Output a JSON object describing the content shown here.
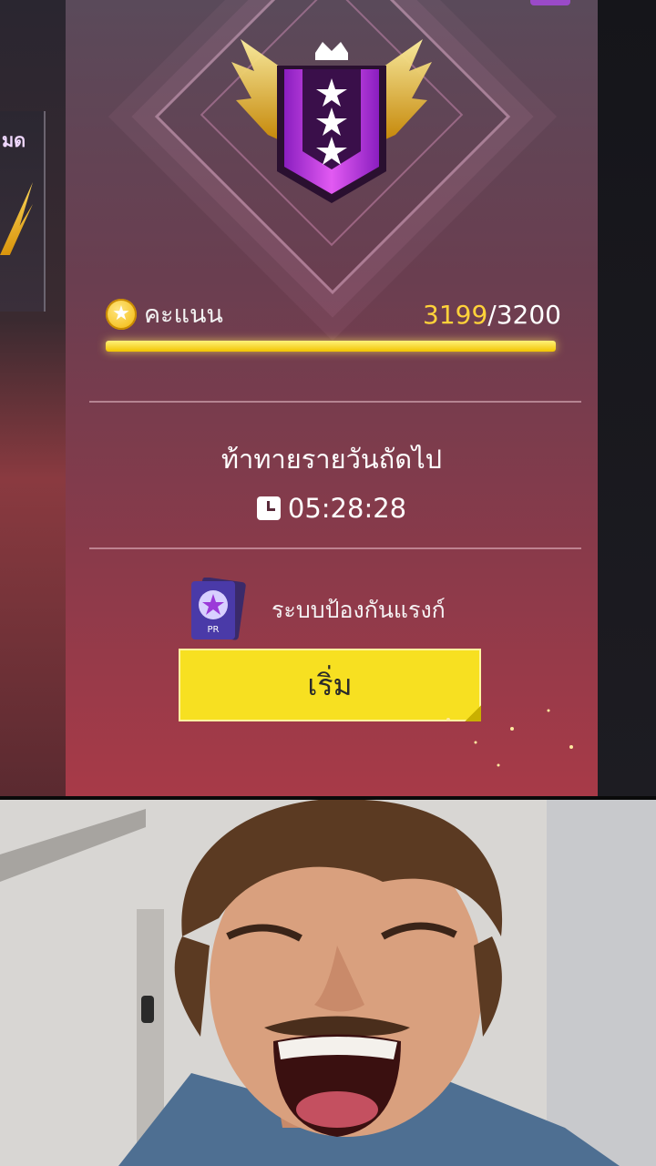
{
  "game": {
    "left_card_label": "มด",
    "score": {
      "label": "คะแนน",
      "current": "3199",
      "separator": "/",
      "max": "3200",
      "progress_fraction": 0.9997
    },
    "daily_challenge": {
      "title": "ท้าทายรายวันถัดไป",
      "countdown": "05:28:28"
    },
    "protection": {
      "label": "ระบบป้องกันแรงก์",
      "card_text": "PR"
    },
    "start_button_label": "เริ่ม",
    "colors": {
      "accent_yellow": "#f7e021",
      "score_gold": "#ffd23a",
      "badge_purple": "#b43ce0"
    },
    "icons": [
      "coin-star-icon",
      "clock-icon",
      "rank-badge-icon",
      "rank-protection-card-icon"
    ]
  },
  "photo": {
    "subject": "laughing-man-reaction"
  }
}
